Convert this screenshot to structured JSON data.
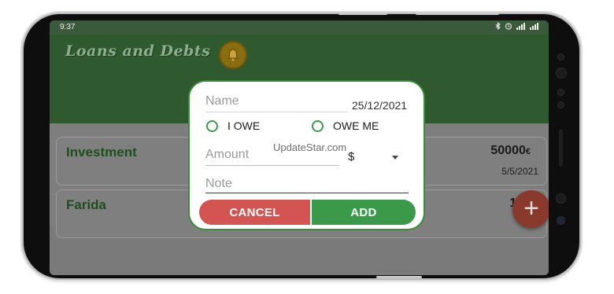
{
  "status": {
    "time": "9:37"
  },
  "app": {
    "title": "Loans and Debts",
    "bell_icon": "bell-icon"
  },
  "list": [
    {
      "name": "Investment",
      "amount": "50000",
      "currency": "€",
      "date": "5/5/2021"
    },
    {
      "name": "Farida",
      "amount": "100",
      "currency": "",
      "date": ""
    }
  ],
  "fab": {
    "label": "+"
  },
  "dialog": {
    "name_placeholder": "Name",
    "date": "25/12/2021",
    "radio_i_owe": "I OWE",
    "radio_owe_me": "OWE ME",
    "amount_placeholder": "Amount",
    "currency": "$",
    "note_placeholder": "Note",
    "cancel_label": "CANCEL",
    "add_label": "ADD"
  },
  "watermark": "UpdateStar.com",
  "colors": {
    "accent": "#3a9a4a",
    "cancel": "#d35450",
    "appbar": "#2f5a2f"
  }
}
